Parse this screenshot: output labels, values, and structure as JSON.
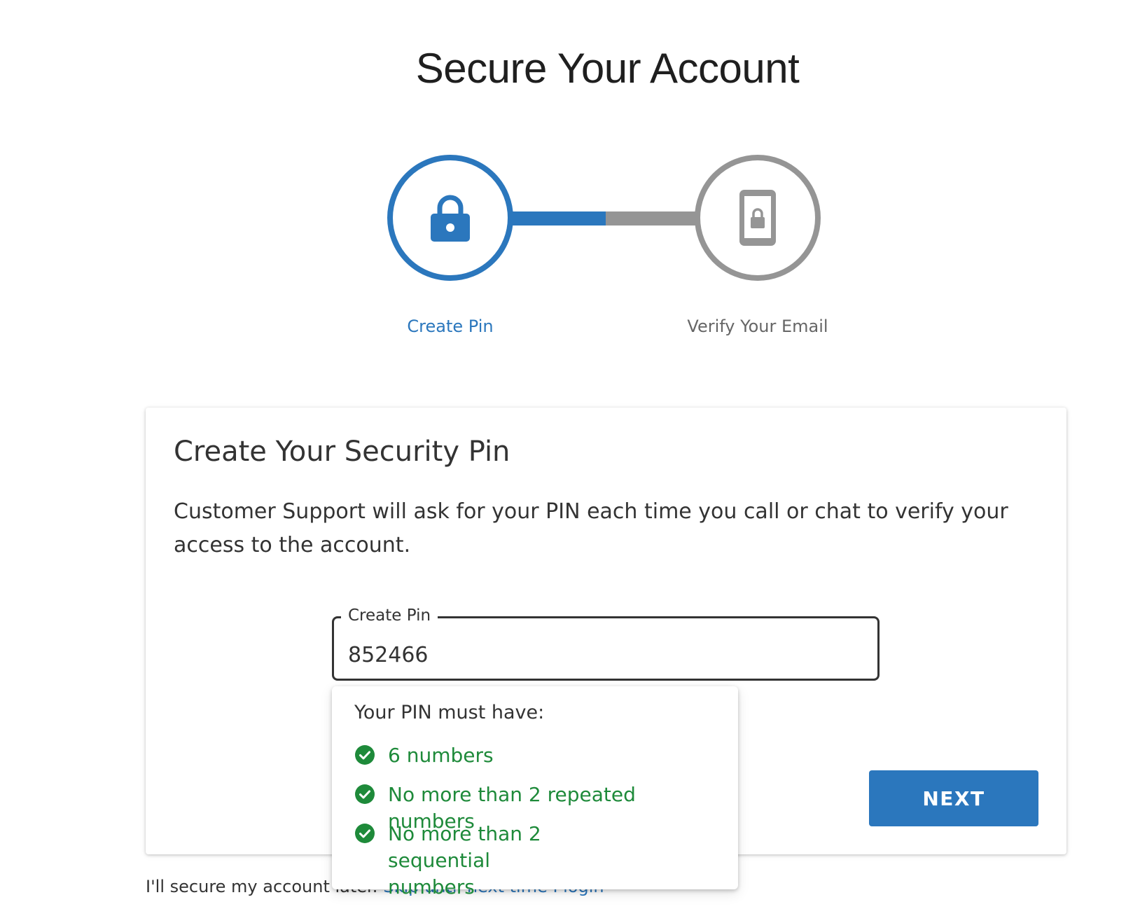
{
  "page": {
    "title": "Secure Your Account"
  },
  "colors": {
    "accent": "#2b77bd",
    "inactive": "#959595",
    "success": "#1e8a3a",
    "text": "#333333"
  },
  "stepper": {
    "steps": [
      {
        "label": "Create Pin",
        "icon": "lock-icon",
        "state": "active"
      },
      {
        "label": "Verify Your Email",
        "icon": "mobile-lock-icon",
        "state": "inactive"
      }
    ],
    "progress_fraction": 0.5
  },
  "card": {
    "title": "Create Your Security Pin",
    "description": "Customer Support will ask for your PIN each time you call or chat to verify your access to the account."
  },
  "pin_field": {
    "label": "Create Pin",
    "value": "852466"
  },
  "requirements": {
    "title": "Your PIN must have:",
    "items": [
      {
        "text": "6 numbers",
        "icon": "check-circle-icon",
        "met": true
      },
      {
        "text": "No more than 2 repeated numbers",
        "icon": "check-circle-icon",
        "met": true
      },
      {
        "text": "No more than 2 sequential numbers",
        "icon": "check-circle-icon",
        "met": true
      }
    ]
  },
  "actions": {
    "next_label": "NEXT"
  },
  "skip": {
    "prefix": "I'll secure my account later.",
    "link_label": "Skip until next time I login"
  }
}
